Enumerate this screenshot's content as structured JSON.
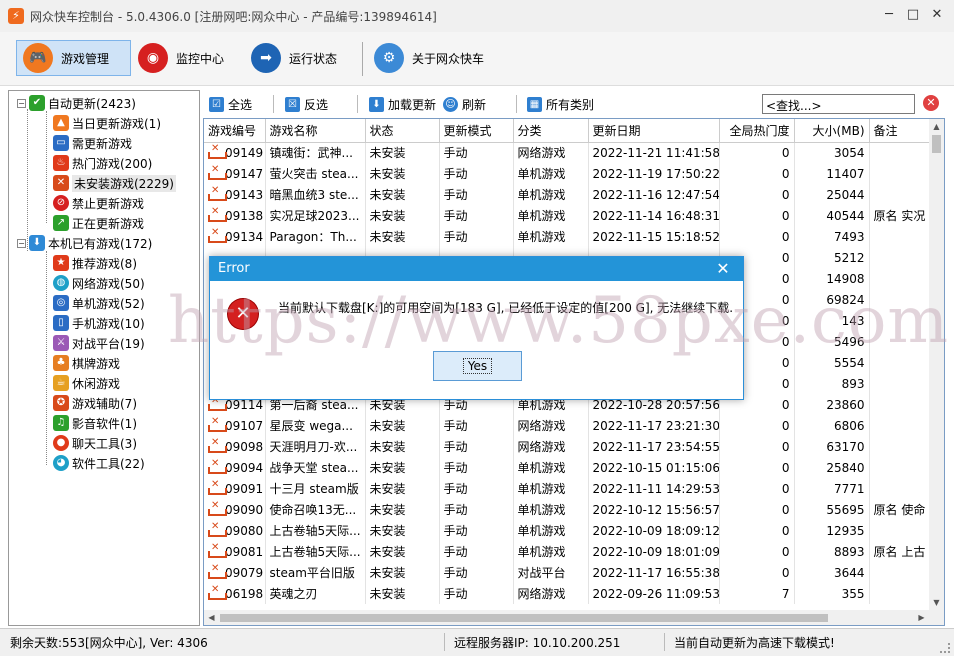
{
  "window": {
    "title": "网众快车控制台 - 5.0.4306.0 [注册网吧:网众中心 - 产品编号:139894614]",
    "buttons": [
      "─",
      "□",
      "✕"
    ]
  },
  "toolbar": {
    "items": [
      {
        "label": "游戏管理",
        "icon": "gamepad-icon",
        "color": "#f07820"
      },
      {
        "label": "监控中心",
        "icon": "monitor-icon",
        "color": "#d62020"
      },
      {
        "label": "运行状态",
        "icon": "arrow-right-icon",
        "color": "#1e64b4"
      },
      {
        "label": "关于网众快车",
        "icon": "gear-icon",
        "color": "#3c8ad6"
      }
    ]
  },
  "tree": {
    "auto_update": "自动更新(2423)",
    "auto_children": [
      "当日更新游戏(1)",
      "需更新游戏",
      "热门游戏(200)",
      "未安装游戏(2229)",
      "禁止更新游戏",
      "正在更新游戏"
    ],
    "local": "本机已有游戏(172)",
    "local_children": [
      "推荐游戏(8)",
      "网络游戏(50)",
      "单机游戏(52)",
      "手机游戏(10)",
      "对战平台(19)",
      "棋牌游戏",
      "休闲游戏",
      "游戏辅助(7)",
      "影音软件(1)",
      "聊天工具(3)",
      "软件工具(22)"
    ]
  },
  "actions": {
    "select_all": "全选",
    "invert": "反选",
    "add_update": "加载更新",
    "refresh": "刷新",
    "all_categories": "所有类别",
    "search_value": "<查找...>"
  },
  "grid": {
    "headers": [
      "游戏编号",
      "游戏名称",
      "状态",
      "更新模式",
      "分类",
      "更新日期",
      "全局热门度",
      "大小(MB)",
      "备注"
    ],
    "rows": [
      [
        "09149",
        "镇魂街：武神...",
        "未安装",
        "手动",
        "网络游戏",
        "2022-11-21 11:41:58",
        "0",
        "3054",
        ""
      ],
      [
        "09147",
        "萤火突击 stea...",
        "未安装",
        "手动",
        "单机游戏",
        "2022-11-19 17:50:22",
        "0",
        "11407",
        ""
      ],
      [
        "09143",
        "暗黑血统3 ste...",
        "未安装",
        "手动",
        "单机游戏",
        "2022-11-16 12:47:54",
        "0",
        "25044",
        ""
      ],
      [
        "09138",
        "实况足球2023...",
        "未安装",
        "手动",
        "单机游戏",
        "2022-11-14 16:48:31",
        "0",
        "40544",
        "原名 实况"
      ],
      [
        "09134",
        "Paragon：Th...",
        "未安装",
        "手动",
        "单机游戏",
        "2022-11-15 15:18:52",
        "0",
        "7493",
        ""
      ],
      [
        "",
        "",
        "",
        "",
        "",
        "",
        "0",
        "5212",
        ""
      ],
      [
        "",
        "",
        "",
        "",
        "",
        "",
        "0",
        "14908",
        ""
      ],
      [
        "",
        "",
        "",
        "",
        "",
        "",
        "0",
        "69824",
        ""
      ],
      [
        "",
        "",
        "",
        "",
        "",
        "",
        "0",
        "143",
        ""
      ],
      [
        "",
        "",
        "",
        "",
        "",
        "",
        "0",
        "5496",
        ""
      ],
      [
        "",
        "",
        "",
        "",
        "",
        "",
        "0",
        "5554",
        ""
      ],
      [
        "",
        "",
        "",
        "",
        "",
        "",
        "0",
        "893",
        ""
      ],
      [
        "09114",
        "第一后裔 stea...",
        "未安装",
        "手动",
        "单机游戏",
        "2022-10-28 20:57:56",
        "0",
        "23860",
        ""
      ],
      [
        "09107",
        "星辰变 wega...",
        "未安装",
        "手动",
        "网络游戏",
        "2022-11-17 23:21:30",
        "0",
        "6806",
        ""
      ],
      [
        "09098",
        "天涯明月刀-欢...",
        "未安装",
        "手动",
        "网络游戏",
        "2022-11-17 23:54:55",
        "0",
        "63170",
        ""
      ],
      [
        "09094",
        "战争天堂 stea...",
        "未安装",
        "手动",
        "单机游戏",
        "2022-10-15 01:15:06",
        "0",
        "25840",
        ""
      ],
      [
        "09091",
        "十三月 steam版",
        "未安装",
        "手动",
        "单机游戏",
        "2022-11-11 14:29:53",
        "0",
        "7771",
        ""
      ],
      [
        "09090",
        "使命召唤13无...",
        "未安装",
        "手动",
        "单机游戏",
        "2022-10-12 15:56:57",
        "0",
        "55695",
        "原名 使命"
      ],
      [
        "09080",
        "上古卷轴5天际...",
        "未安装",
        "手动",
        "单机游戏",
        "2022-10-09 18:09:12",
        "0",
        "12935",
        ""
      ],
      [
        "09081",
        "上古卷轴5天际...",
        "未安装",
        "手动",
        "单机游戏",
        "2022-10-09 18:01:09",
        "0",
        "8893",
        "原名 上古"
      ],
      [
        "09079",
        "steam平台旧版",
        "未安装",
        "手动",
        "对战平台",
        "2022-11-17 16:55:38",
        "0",
        "3644",
        ""
      ],
      [
        "06198",
        "英魂之刃",
        "未安装",
        "手动",
        "网络游戏",
        "2022-09-26 11:09:53",
        "7",
        "355",
        ""
      ]
    ]
  },
  "status": {
    "days": "剩余天数:553[网众中心], Ver: 4306",
    "server": "远程服务器IP: 10.10.200.251",
    "mode": "当前自动更新为高速下载模式!"
  },
  "dialog": {
    "title": "Error",
    "close": "✕",
    "message": "当前默认下载盘[K:]的可用空间为[183 G], 已经低于设定的值[200 G], 无法继续下载.",
    "yes": "Yes"
  },
  "watermark": "https://www.58pxe.com"
}
